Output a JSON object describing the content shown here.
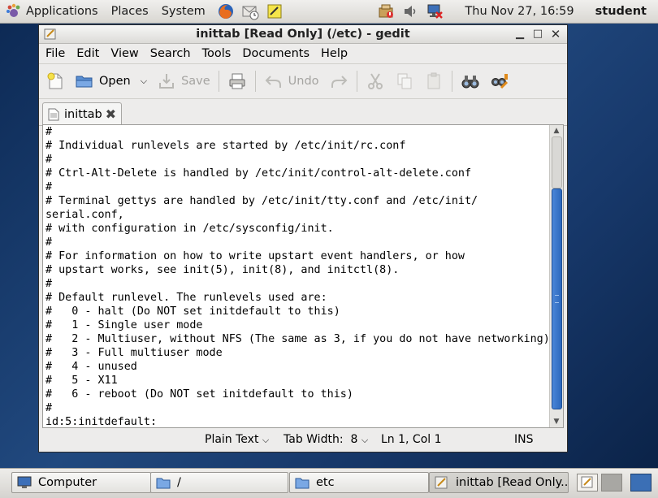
{
  "top_panel": {
    "menus": [
      "Applications",
      "Places",
      "System"
    ],
    "clock": "Thu Nov 27, 16:59",
    "user": "student"
  },
  "window": {
    "title": "inittab [Read Only] (/etc) - gedit",
    "menubar": [
      "File",
      "Edit",
      "View",
      "Search",
      "Tools",
      "Documents",
      "Help"
    ],
    "toolbar": {
      "open_label": "Open",
      "save_label": "Save",
      "undo_label": "Undo"
    },
    "tab_label": "inittab",
    "lines": [
      "#",
      "# Individual runlevels are started by /etc/init/rc.conf",
      "#",
      "# Ctrl-Alt-Delete is handled by /etc/init/control-alt-delete.conf",
      "#",
      "# Terminal gettys are handled by /etc/init/tty.conf and /etc/init/",
      "serial.conf,",
      "# with configuration in /etc/sysconfig/init.",
      "#",
      "# For information on how to write upstart event handlers, or how",
      "# upstart works, see init(5), init(8), and initctl(8).",
      "#",
      "# Default runlevel. The runlevels used are:",
      "#   0 - halt (Do NOT set initdefault to this)",
      "#   1 - Single user mode",
      "#   2 - Multiuser, without NFS (The same as 3, if you do not have networking)",
      "#   3 - Full multiuser mode",
      "#   4 - unused",
      "#   5 - X11",
      "#   6 - reboot (Do NOT set initdefault to this)",
      "#",
      "id:5:initdefault:"
    ],
    "status": {
      "language": "Plain Text",
      "tab_width": "Tab Width:  8",
      "position": "Ln 1, Col 1",
      "mode": "INS"
    }
  },
  "taskbar": {
    "items": [
      "Computer",
      "/",
      "etc",
      "inittab [Read Only..."
    ]
  },
  "colors": {
    "scroll_thumb": "#2c68bd",
    "desktop": "#1d3f6e"
  }
}
